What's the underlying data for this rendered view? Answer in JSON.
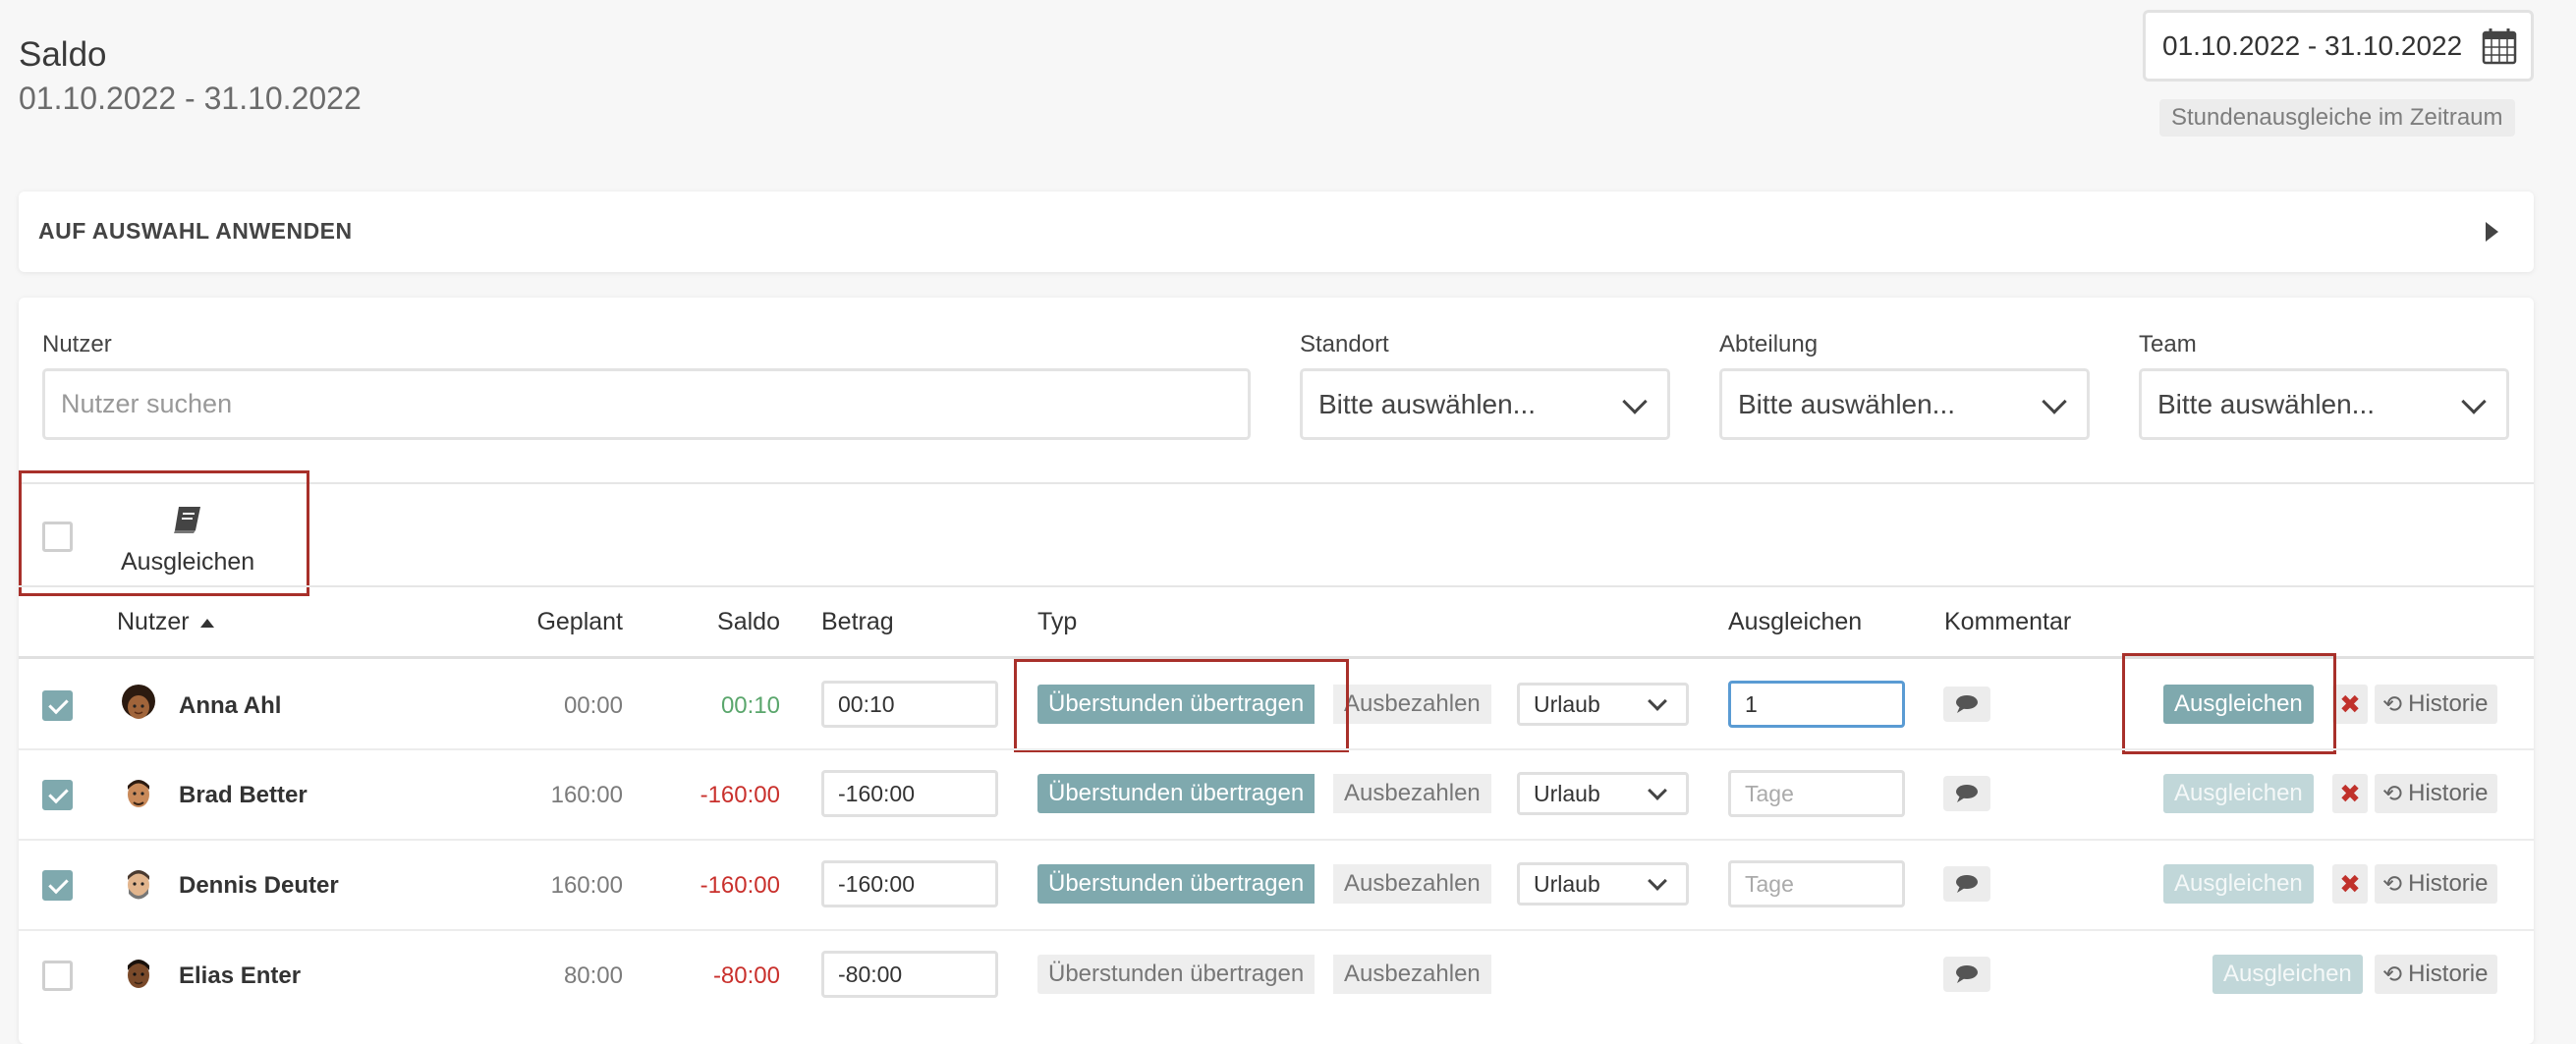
{
  "header": {
    "title": "Saldo",
    "subtitle": "01.10.2022 - 31.10.2022",
    "date_range_value": "01.10.2022 - 31.10.2022",
    "range_badge": "Stundenausgleiche im Zeitraum"
  },
  "apply_panel": {
    "label": "AUF AUSWAHL ANWENDEN"
  },
  "filters": {
    "user_label": "Nutzer",
    "user_placeholder": "Nutzer suchen",
    "location_label": "Standort",
    "location_value": "Bitte auswählen...",
    "department_label": "Abteilung",
    "department_value": "Bitte auswählen...",
    "team_label": "Team",
    "team_value": "Bitte auswählen..."
  },
  "bulk_action": {
    "label": "Ausgleichen",
    "icon": "book-icon"
  },
  "table": {
    "headers": {
      "user": "Nutzer",
      "planned": "Geplant",
      "saldo": "Saldo",
      "amount": "Betrag",
      "type": "Typ",
      "compensate": "Ausgleichen",
      "comment": "Kommentar"
    },
    "labels": {
      "transfer": "Überstunden übertragen",
      "payout": "Ausbezahlen",
      "compensate_btn": "Ausgleichen",
      "history": "Historie",
      "days_placeholder": "Tage"
    },
    "rows": [
      {
        "name": "Anna Ahl",
        "planned": "00:00",
        "saldo": "00:10",
        "amount": "00:10",
        "select": "Urlaub",
        "days": "1",
        "checked": true
      },
      {
        "name": "Brad Better",
        "planned": "160:00",
        "saldo": "-160:00",
        "amount": "-160:00",
        "select": "Urlaub",
        "days": "",
        "checked": true
      },
      {
        "name": "Dennis Deuter",
        "planned": "160:00",
        "saldo": "-160:00",
        "amount": "-160:00",
        "select": "Urlaub",
        "days": "",
        "checked": true
      },
      {
        "name": "Elias Enter",
        "planned": "80:00",
        "saldo": "-80:00",
        "amount": "-80:00",
        "select": "",
        "days": "",
        "checked": false
      }
    ]
  },
  "colors": {
    "accent": "#7fa9ae",
    "positive": "#5aa66c",
    "negative": "#c9302c",
    "highlight": "#a8302a"
  }
}
